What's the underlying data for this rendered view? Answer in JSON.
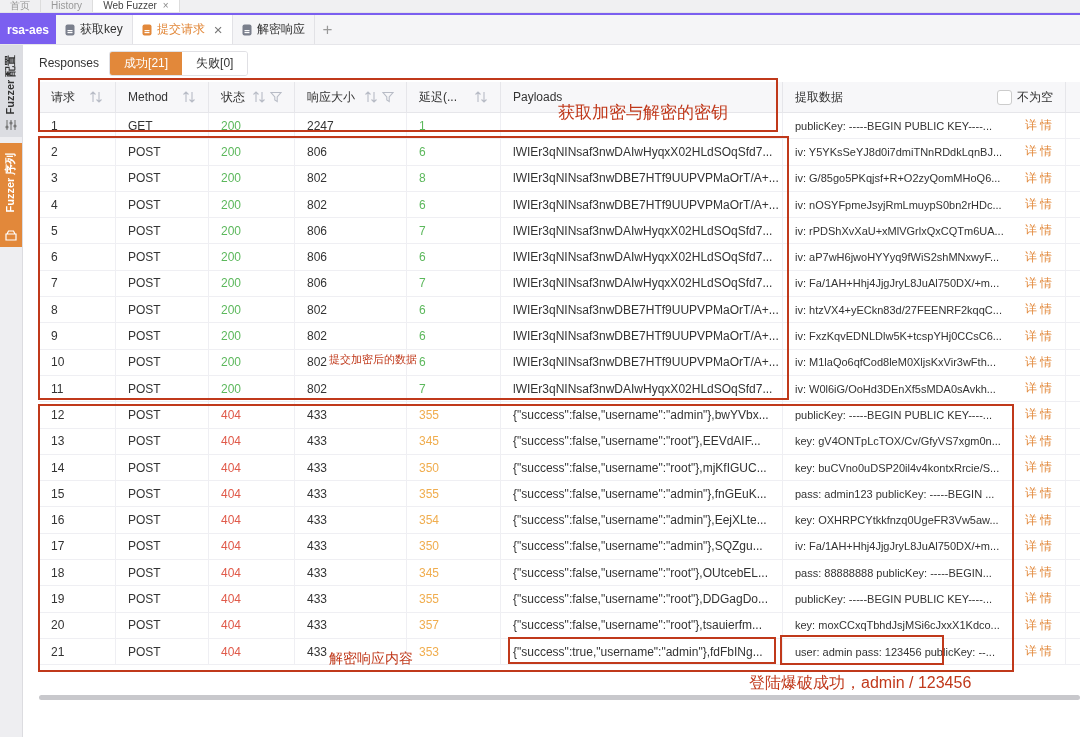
{
  "top_tabs": [
    {
      "label": "首页",
      "selected": false
    },
    {
      "label": "History",
      "selected": false
    },
    {
      "label": "Web Fuzzer",
      "selected": true,
      "close": "×"
    }
  ],
  "project": "rsa-aes",
  "tabs": [
    {
      "label": "获取key",
      "selected": false
    },
    {
      "label": "提交请求",
      "selected": true,
      "close": "×"
    },
    {
      "label": "解密响应",
      "selected": false
    }
  ],
  "add_tab": "+",
  "sidebar": [
    {
      "label": "Fuzzer 配置",
      "selected": false
    },
    {
      "label": "Fuzzer 序列",
      "selected": true
    }
  ],
  "responses": {
    "label": "Responses",
    "filters": [
      {
        "label": "成功[21]",
        "selected": true
      },
      {
        "label": "失败[0]",
        "selected": false
      }
    ]
  },
  "table": {
    "columns": [
      {
        "label": "请求",
        "sort": true,
        "filter": false
      },
      {
        "label": "Method",
        "sort": true,
        "filter": false
      },
      {
        "label": "状态",
        "sort": true,
        "filter": true
      },
      {
        "label": "响应大小",
        "sort": true,
        "filter": true
      },
      {
        "label": "延迟(...",
        "sort": true,
        "filter": false
      },
      {
        "label": "Payloads",
        "sort": false,
        "filter": false
      },
      {
        "label": "提取数据",
        "sort": false,
        "filter": false,
        "checkbox": {
          "label": "不为空",
          "checked": false
        }
      }
    ],
    "rows": [
      {
        "id": "1",
        "method": "GET",
        "status": "200",
        "size": "2247",
        "delay": "1",
        "kind": "success",
        "extract": "publicKey: -----BEGIN PUBLIC KEY----...",
        "action": "详 情"
      },
      {
        "id": "2",
        "method": "POST",
        "status": "200",
        "size": "806",
        "delay": "6",
        "kind": "success",
        "payload": "lWIEr3qNINsaf3nwDAIwHyqxX02HLdSOqSfd7...",
        "extract": "iv: Y5YKsSeYJ8d0i7dmiTNnRDdkLqnBJ...",
        "action": "详 情"
      },
      {
        "id": "3",
        "method": "POST",
        "status": "200",
        "size": "802",
        "delay": "8",
        "kind": "success",
        "payload": "lWIEr3qNINsaf3nwDBE7HTf9UUPVPMaOrT/A+...",
        "extract": "iv: G/85go5PKqjsf+R+O2zyQomMHoQ6...",
        "action": "详 情"
      },
      {
        "id": "4",
        "method": "POST",
        "status": "200",
        "size": "802",
        "delay": "6",
        "kind": "success",
        "payload": "lWIEr3qNINsaf3nwDBE7HTf9UUPVPMaOrT/A+...",
        "extract": "iv: nOSYFpmeJsyjRmLmuypS0bn2rHDc...",
        "action": "详 情"
      },
      {
        "id": "5",
        "method": "POST",
        "status": "200",
        "size": "806",
        "delay": "7",
        "kind": "success",
        "payload": "lWIEr3qNINsaf3nwDAIwHyqxX02HLdSOqSfd7...",
        "extract": "iv: rPDShXvXaU+xMlVGrlxQxCQTm6UA...",
        "action": "详 情"
      },
      {
        "id": "6",
        "method": "POST",
        "status": "200",
        "size": "806",
        "delay": "6",
        "kind": "success",
        "payload": "lWIEr3qNINsaf3nwDAIwHyqxX02HLdSOqSfd7...",
        "extract": "iv: aP7wH6jwoHYYyq9fWiS2shMNxwyF...",
        "action": "详 情"
      },
      {
        "id": "7",
        "method": "POST",
        "status": "200",
        "size": "806",
        "delay": "7",
        "kind": "success",
        "payload": "lWIEr3qNINsaf3nwDAIwHyqxX02HLdSOqSfd7...",
        "extract": "iv: Fa/1AH+Hhj4JjgJryL8JuAl750DX/+m...",
        "action": "详 情"
      },
      {
        "id": "8",
        "method": "POST",
        "status": "200",
        "size": "802",
        "delay": "6",
        "kind": "success",
        "payload": "lWIEr3qNINsaf3nwDBE7HTf9UUPVPMaOrT/A+...",
        "extract": "iv: htzVX4+yECkn83d/27FEENRF2kqqC...",
        "action": "详 情"
      },
      {
        "id": "9",
        "method": "POST",
        "status": "200",
        "size": "802",
        "delay": "6",
        "kind": "success",
        "payload": "lWIEr3qNINsaf3nwDBE7HTf9UUPVPMaOrT/A+...",
        "extract": "iv: FxzKqvEDNLDlw5K+tcspYHj0CCsC6...",
        "action": "详 情"
      },
      {
        "id": "10",
        "method": "POST",
        "status": "200",
        "size": "802",
        "delay": "6",
        "kind": "success",
        "payload": "lWIEr3qNINsaf3nwDBE7HTf9UUPVPMaOrT/A+...",
        "extract": "iv: M1laQo6qfCod8leM0XljsKxVir3wFth...",
        "action": "详 情"
      },
      {
        "id": "11",
        "method": "POST",
        "status": "200",
        "size": "802",
        "delay": "7",
        "kind": "success",
        "payload": "lWIEr3qNINsaf3nwDAIwHyqxX02HLdSOqSfd7...",
        "extract": "iv: W0l6iG/OoHd3DEnXf5sMDA0sAvkh...",
        "action": "详 情"
      },
      {
        "id": "12",
        "method": "POST",
        "status": "404",
        "size": "433",
        "delay": "355",
        "kind": "error",
        "payload": "{\"success\":false,\"username\":\"admin\"},bwYVbx...",
        "extract": "publicKey: -----BEGIN PUBLIC KEY----...",
        "action": "详 情"
      },
      {
        "id": "13",
        "method": "POST",
        "status": "404",
        "size": "433",
        "delay": "345",
        "kind": "error",
        "payload": "{\"success\":false,\"username\":\"root\"},EEVdAIF...",
        "extract": "key: gV4ONTpLcTOX/Cv/GfyVS7xgm0n...",
        "action": "详 情"
      },
      {
        "id": "14",
        "method": "POST",
        "status": "404",
        "size": "433",
        "delay": "350",
        "kind": "error",
        "payload": "{\"success\":false,\"username\":\"root\"},mjKfIGUC...",
        "extract": "key: buCVno0uDSP20il4v4kontxRrcie/S...",
        "action": "详 情"
      },
      {
        "id": "15",
        "method": "POST",
        "status": "404",
        "size": "433",
        "delay": "355",
        "kind": "error",
        "payload": "{\"success\":false,\"username\":\"admin\"},fnGEuK...",
        "extract": "pass: admin123 publicKey: -----BEGIN ...",
        "action": "详 情"
      },
      {
        "id": "16",
        "method": "POST",
        "status": "404",
        "size": "433",
        "delay": "354",
        "kind": "error",
        "payload": "{\"success\":false,\"username\":\"admin\"},EejXLte...",
        "extract": "key: OXHRPCYtkkfnzq0UgeFR3Vw5aw...",
        "action": "详 情"
      },
      {
        "id": "17",
        "method": "POST",
        "status": "404",
        "size": "433",
        "delay": "350",
        "kind": "error",
        "payload": "{\"success\":false,\"username\":\"admin\"},SQZgu...",
        "extract": "iv: Fa/1AH+Hhj4JjgJryL8JuAl750DX/+m...",
        "action": "详 情"
      },
      {
        "id": "18",
        "method": "POST",
        "status": "404",
        "size": "433",
        "delay": "345",
        "kind": "error",
        "payload": "{\"success\":false,\"username\":\"root\"},OUtcebEL...",
        "extract": "pass: 88888888 publicKey: -----BEGIN...",
        "action": "详 情"
      },
      {
        "id": "19",
        "method": "POST",
        "status": "404",
        "size": "433",
        "delay": "355",
        "kind": "error",
        "payload": "{\"success\":false,\"username\":\"root\"},DDGagDo...",
        "extract": "publicKey: -----BEGIN PUBLIC KEY----...",
        "action": "详 情"
      },
      {
        "id": "20",
        "method": "POST",
        "status": "404",
        "size": "433",
        "delay": "357",
        "kind": "error",
        "payload": "{\"success\":false,\"username\":\"root\"},tsauierfm...",
        "extract": "key: moxCCxqTbhdJsjMSi6cJxxX1Kdco...",
        "action": "详 情"
      },
      {
        "id": "21",
        "method": "POST",
        "status": "404",
        "size": "433",
        "delay": "353",
        "kind": "error",
        "payload": "{\"success\":true,\"username\":\"admin\"},fdFbINg...",
        "extract": "user: admin pass: 123456 publicKey: --...",
        "action": "详 情"
      }
    ]
  },
  "annotations": [
    {
      "label": "获取加密与解密的密钥"
    },
    {
      "label": "提交加密后的数据"
    },
    {
      "label": "解密响应内容"
    },
    {
      "label": "登陆爆破成功，admin / 123456"
    }
  ]
}
